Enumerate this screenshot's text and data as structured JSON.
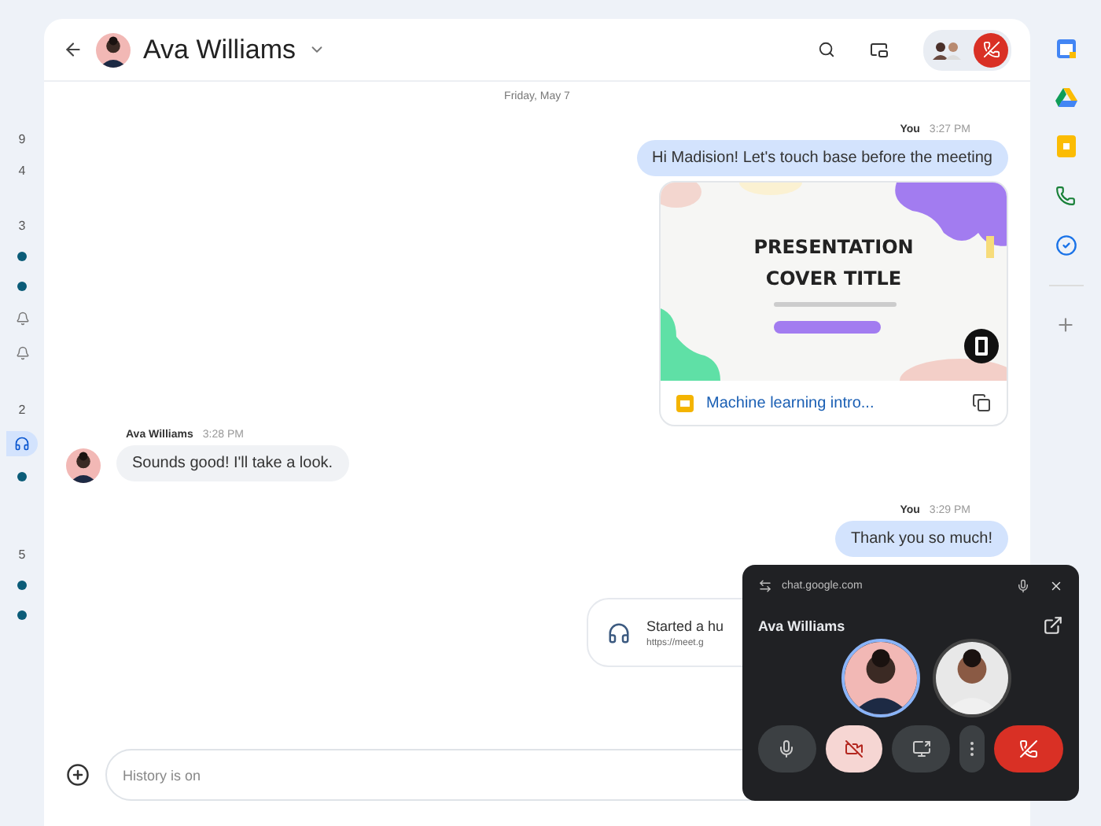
{
  "left_strip": [
    {
      "kind": "count",
      "text": "9"
    },
    {
      "kind": "count",
      "text": "4"
    },
    {
      "kind": "gap"
    },
    {
      "kind": "count",
      "text": "3"
    },
    {
      "kind": "dot"
    },
    {
      "kind": "dot"
    },
    {
      "kind": "bell"
    },
    {
      "kind": "bell"
    },
    {
      "kind": "gap"
    },
    {
      "kind": "count",
      "text": "2"
    },
    {
      "kind": "headphones",
      "selected": true
    },
    {
      "kind": "dot"
    },
    {
      "kind": "gap"
    },
    {
      "kind": "gap"
    },
    {
      "kind": "count",
      "text": "5"
    },
    {
      "kind": "dot"
    },
    {
      "kind": "dot"
    }
  ],
  "header": {
    "name": "Ava Williams",
    "call_active": true
  },
  "date_divider": "Friday, May 7",
  "messages": [
    {
      "kind": "outgoing",
      "sender": "You",
      "time": "3:27 PM",
      "text": "Hi Madision! Let's touch base before the meeting",
      "attachment": {
        "slide_title": "PRESENTATION COVER TITLE",
        "file_name": "Machine learning intro..."
      }
    },
    {
      "kind": "incoming",
      "sender": "Ava Williams",
      "time": "3:28 PM",
      "text": "Sounds good! I'll take a look."
    },
    {
      "kind": "outgoing",
      "sender": "You",
      "time": "3:29 PM",
      "text": "Thank you so much!"
    },
    {
      "kind": "huddle",
      "title": "Started a hu",
      "link": "https://meet.g"
    }
  ],
  "composer": {
    "placeholder": "History is on"
  },
  "right_rail": [
    {
      "kind": "calendar"
    },
    {
      "kind": "drive"
    },
    {
      "kind": "keep"
    },
    {
      "kind": "phone"
    },
    {
      "kind": "tasks"
    },
    {
      "kind": "divider"
    },
    {
      "kind": "add"
    }
  ],
  "call_popup": {
    "url": "chat.google.com",
    "name": "Ava Williams",
    "controls": [
      {
        "kind": "mic",
        "on": true
      },
      {
        "kind": "camera",
        "on": false
      },
      {
        "kind": "present"
      },
      {
        "kind": "more"
      },
      {
        "kind": "end"
      }
    ]
  }
}
